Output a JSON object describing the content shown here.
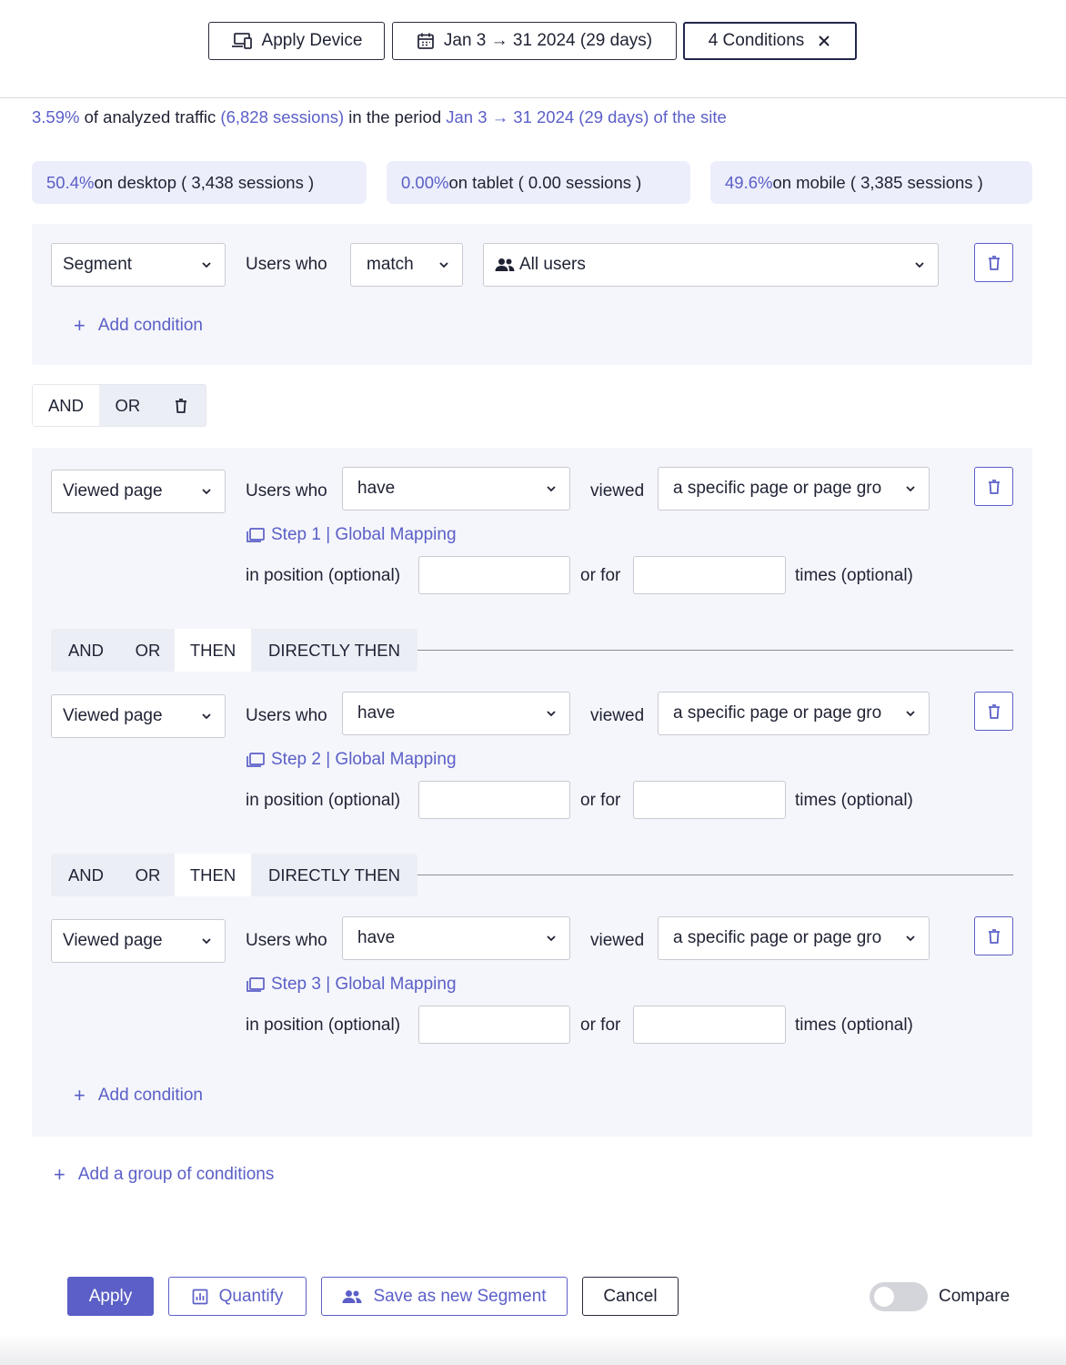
{
  "topbar": {
    "device_label": "Apply Device",
    "date_label": "Jan 3 → 31 2024 (29 days)",
    "conditions_label": "4 Conditions"
  },
  "summary": {
    "pct": "3.59%",
    "text1": " of analyzed traffic ",
    "sessions": "(6,828 sessions)",
    "text2": " in the period ",
    "period": "Jan 3 → 31 2024 (29 days) of the site"
  },
  "devices": [
    {
      "pct": "50.4%",
      "text": " on desktop ( 3,438 sessions )"
    },
    {
      "pct": "0.00%",
      "text": " on tablet ( 0.00 sessions )"
    },
    {
      "pct": "49.6%",
      "text": " on mobile ( 3,385 sessions )"
    }
  ],
  "group1": {
    "type": "Segment",
    "users_who": "Users who",
    "match": "match",
    "audience": "All users",
    "add_condition": "Add condition"
  },
  "group_operator": {
    "and": "AND",
    "or": "OR"
  },
  "conditions": [
    {
      "type": "Viewed page",
      "users_who": "Users who",
      "have": "have",
      "viewed": "viewed",
      "target": "a specific page or page gro",
      "step": "Step 1 | Global Mapping",
      "position": "in position (optional)",
      "or_for": "or for",
      "times": "times (optional)"
    },
    {
      "type": "Viewed page",
      "users_who": "Users who",
      "have": "have",
      "viewed": "viewed",
      "target": "a specific page or page gro",
      "step": "Step 2 | Global Mapping",
      "position": "in position (optional)",
      "or_for": "or for",
      "times": "times (optional)"
    },
    {
      "type": "Viewed page",
      "users_who": "Users who",
      "have": "have",
      "viewed": "viewed",
      "target": "a specific page or page gro",
      "step": "Step 3 | Global Mapping",
      "position": "in position (optional)",
      "or_for": "or for",
      "times": "times (optional)"
    }
  ],
  "sequence_ops": {
    "and": "AND",
    "or": "OR",
    "then": "THEN",
    "directly_then": "DIRECTLY THEN",
    "selected": "THEN"
  },
  "group2": {
    "add_condition": "Add condition"
  },
  "add_group": "Add a group of conditions",
  "footer": {
    "apply": "Apply",
    "quantify": "Quantify",
    "save_segment": "Save as new Segment",
    "cancel": "Cancel",
    "compare": "Compare",
    "compare_on": false
  },
  "colors": {
    "accent": "#5b5fc7",
    "group_bg": "#f5f6fb",
    "pill_bg": "#eceefb"
  }
}
